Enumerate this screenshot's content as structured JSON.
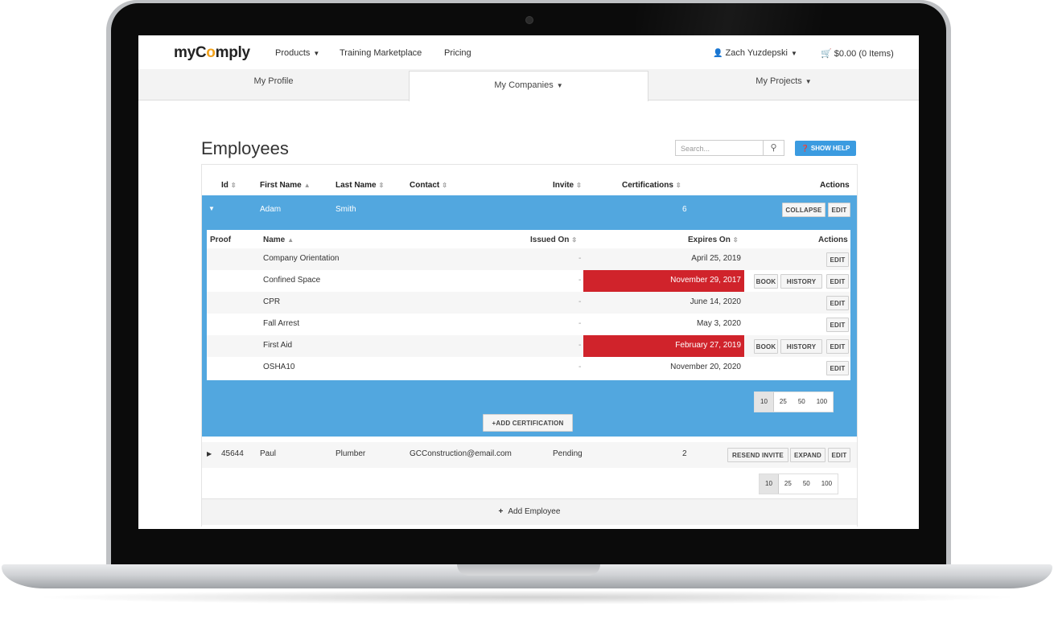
{
  "nav": {
    "logo_pre": "myC",
    "logo_o": "o",
    "logo_post": "mply",
    "products": "Products",
    "training": "Training Marketplace",
    "pricing": "Pricing",
    "user": "Zach Yuzdepski",
    "cart": "$0.00 (0 Items)"
  },
  "tabs": [
    "My Profile",
    "My Companies",
    "My Projects"
  ],
  "page": {
    "title": "Employees",
    "search_placeholder": "Search...",
    "help": "SHOW HELP"
  },
  "columns": {
    "id": "Id",
    "first": "First Name",
    "last": "Last Name",
    "contact": "Contact",
    "invite": "Invite",
    "certs": "Certifications",
    "actions": "Actions"
  },
  "expanded_employee": {
    "first": "Adam",
    "last": "Smith",
    "certs": "6",
    "collapse": "COLLAPSE",
    "edit": "EDIT"
  },
  "sub_columns": {
    "proof": "Proof",
    "name": "Name",
    "issued": "Issued On",
    "expires": "Expires On",
    "actions": "Actions"
  },
  "certifications": [
    {
      "name": "Company Orientation",
      "issued": "-",
      "expires": "April 25, 2019",
      "expired": false
    },
    {
      "name": "Confined Space",
      "issued": "-",
      "expires": "November 29, 2017",
      "expired": true
    },
    {
      "name": "CPR",
      "issued": "-",
      "expires": "June 14, 2020",
      "expired": false
    },
    {
      "name": "Fall Arrest",
      "issued": "-",
      "expires": "May 3, 2020",
      "expired": false
    },
    {
      "name": "First Aid",
      "issued": "-",
      "expires": "February 27, 2019",
      "expired": true
    },
    {
      "name": "OSHA10",
      "issued": "-",
      "expires": "November 20, 2020",
      "expired": false
    }
  ],
  "buttons": {
    "book": "BOOK",
    "history": "HISTORY",
    "edit": "EDIT",
    "add_cert": "ADD CERTIFICATION",
    "resend": "RESEND INVITE",
    "expand": "EXPAND",
    "add_employee": "Add Employee"
  },
  "page_sizes": [
    "10",
    "25",
    "50",
    "100"
  ],
  "employee2": {
    "id": "45644",
    "first": "Paul",
    "last": "Plumber",
    "contact": "GCConstruction@email.com",
    "invite": "Pending",
    "certs": "2"
  },
  "colors": {
    "accent_blue": "#52a7df",
    "help_blue": "#3b9be0",
    "expired_red": "#d0232b",
    "logo_orange": "#f2a21b"
  }
}
